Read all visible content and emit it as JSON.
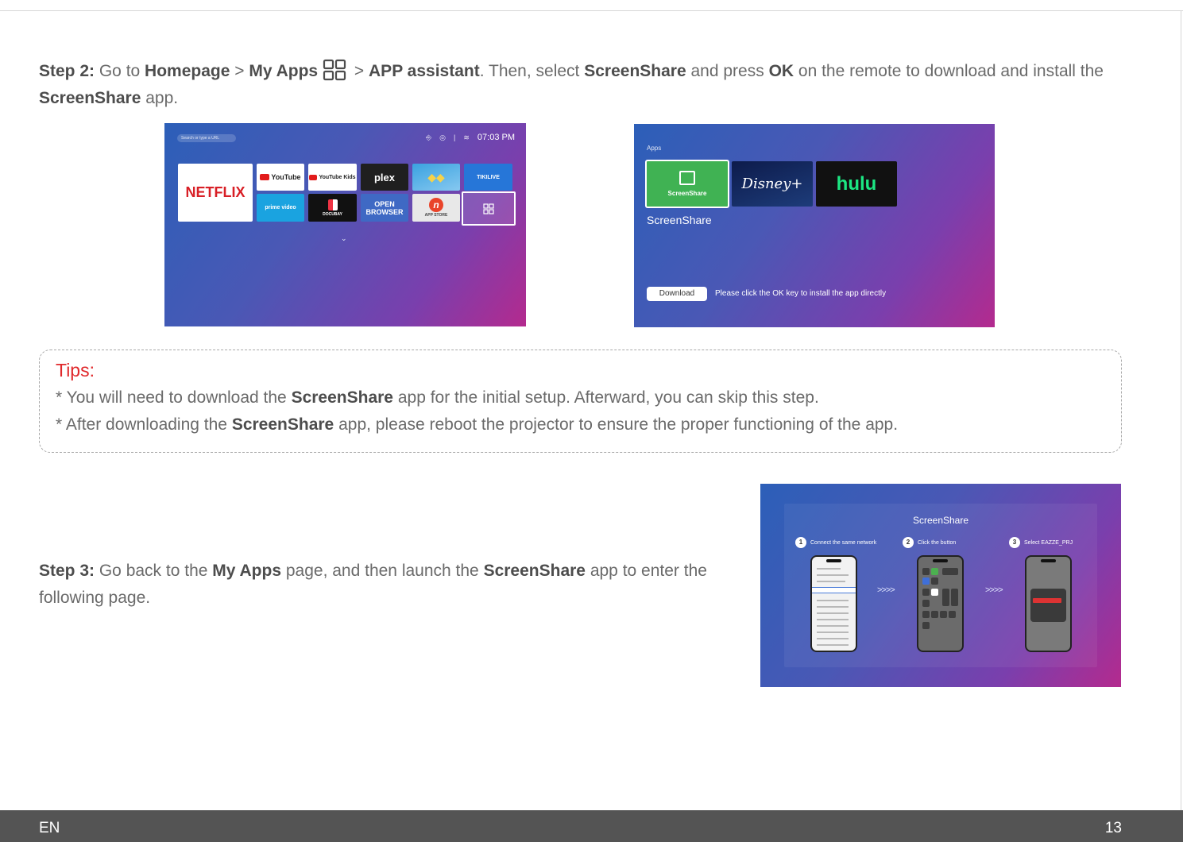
{
  "step2": {
    "label": "Step 2:",
    "t1": " Go to ",
    "homepage": "Homepage",
    "t2": " > ",
    "myapps": "My Apps",
    "t3": " > ",
    "assistant": "APP assistant",
    "t4": ". Then, select ",
    "screenshare": "ScreenShare",
    "t5": " and press ",
    "ok": "OK",
    "t6": " on the remote to download and install the ",
    "screenshare2": "ScreenShare",
    "t7": " app."
  },
  "screen1": {
    "search": "Search or type a URL",
    "time": "07:03 PM",
    "tiles": {
      "netflix": "NETFLIX",
      "youtube": "YouTube",
      "youtube_kids": "YouTube Kids",
      "plex": "plex",
      "tikilive": "TIKILIVE",
      "prime": "prime video",
      "docubay": "DOCUBAY",
      "open_browser": "OPEN BROWSER",
      "app_store": "APP STORE"
    }
  },
  "screen2": {
    "section": "Apps",
    "tile_label": "ScreenShare",
    "disney": "Disney+",
    "hulu": "hulu",
    "selected_name": "ScreenShare",
    "download_button": "Download",
    "hint": "Please click the OK key to install the app directly"
  },
  "tips": {
    "title": "Tips:",
    "tip1_a": "* You will need to download the ",
    "tip1_b": "ScreenShare",
    "tip1_c": " app for the initial setup. Afterward, you can skip this step.",
    "tip2_a": "* After downloading the ",
    "tip2_b": "ScreenShare",
    "tip2_c": " app, please reboot the projector to ensure the proper functioning of the app."
  },
  "step3": {
    "label": "Step 3:",
    "t1": " Go back to the ",
    "myapps": "My Apps",
    "t2": " page, and then launch the ",
    "screenshare": "ScreenShare",
    "t3": " app to enter the following page."
  },
  "screen3": {
    "title": "ScreenShare",
    "steps": [
      {
        "num": "1",
        "text": "Connect the same network"
      },
      {
        "num": "2",
        "text": "Click the button"
      },
      {
        "num": "3",
        "text": "Select EAZZE_PRJ"
      }
    ],
    "arrows": ">>>>"
  },
  "footer": {
    "language": "EN",
    "page_number": "13"
  }
}
